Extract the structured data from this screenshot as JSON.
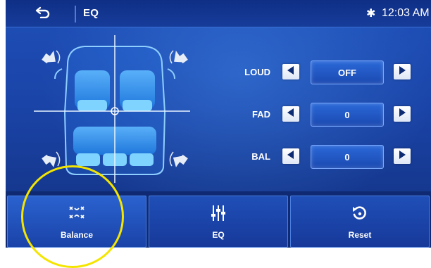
{
  "header": {
    "title": "EQ",
    "time": "12:03 AM"
  },
  "controls": [
    {
      "label": "LOUD",
      "value": "OFF"
    },
    {
      "label": "FAD",
      "value": "0"
    },
    {
      "label": "BAL",
      "value": "0"
    }
  ],
  "tabs": {
    "balance": "Balance",
    "eq": "EQ",
    "reset": "Reset"
  },
  "colors": {
    "background": "#1a43a6",
    "accent": "#79a8ff",
    "highlight_circle": "#f4e500"
  },
  "icons": {
    "back": "back-arrow-icon",
    "bluetooth": "bluetooth-icon",
    "speaker": "speaker-icon",
    "balance": "balance-icon",
    "eq": "eq-sliders-icon",
    "reset": "reset-icon"
  }
}
